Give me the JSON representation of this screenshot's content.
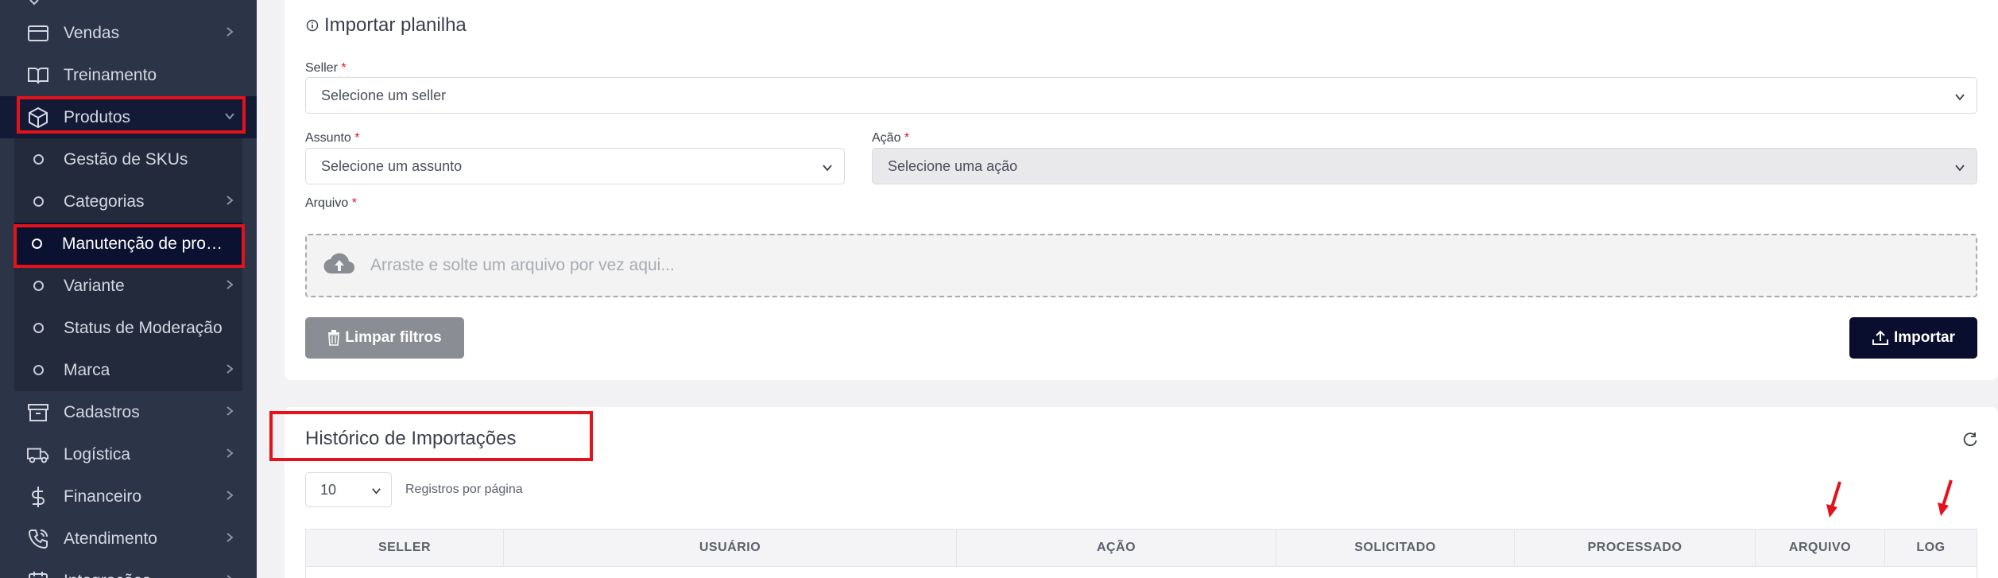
{
  "sidebar": {
    "items": [
      {
        "label": "Vendas",
        "icon": "credit-card-icon"
      },
      {
        "label": "Treinamento",
        "icon": "book-icon"
      },
      {
        "label": "Produtos",
        "icon": "box-icon"
      },
      {
        "label": "Cadastros",
        "icon": "archive-icon"
      },
      {
        "label": "Logística",
        "icon": "truck-icon"
      },
      {
        "label": "Financeiro",
        "icon": "dollar-icon"
      },
      {
        "label": "Atendimento",
        "icon": "phone-icon"
      },
      {
        "label": "Integrações",
        "icon": "calendar-icon"
      }
    ],
    "subitems": [
      {
        "label": "Gestão de SKUs"
      },
      {
        "label": "Categorias"
      },
      {
        "label": "Manutenção de produtos"
      },
      {
        "label": "Variante"
      },
      {
        "label": "Status de Moderação"
      },
      {
        "label": "Marca"
      }
    ]
  },
  "import_form": {
    "title": "Importar planilha",
    "seller_label": "Seller",
    "seller_placeholder": "Selecione um seller",
    "subject_label": "Assunto",
    "subject_placeholder": "Selecione um assunto",
    "action_label": "Ação",
    "action_placeholder": "Selecione uma ação",
    "file_label": "Arquivo",
    "required_mark": "*",
    "dropzone_text": "Arraste e solte um arquivo por vez aqui...",
    "clear_button": "Limpar filtros",
    "import_button": "Importar"
  },
  "history": {
    "title": "Histórico de Importações",
    "per_page_value": "10",
    "per_page_label": "Registros por página",
    "columns": [
      "SELLER",
      "USUÁRIO",
      "AÇÃO",
      "SOLICITADO",
      "PROCESSADO",
      "ARQUIVO",
      "LOG"
    ]
  },
  "colors": {
    "sidebar_bg": "#2c3447",
    "sidebar_active": "#0b1130",
    "primary_button": "#0a0e2e",
    "secondary_button": "#8a8d93",
    "highlight": "#e3121b",
    "required": "#e3121b"
  }
}
